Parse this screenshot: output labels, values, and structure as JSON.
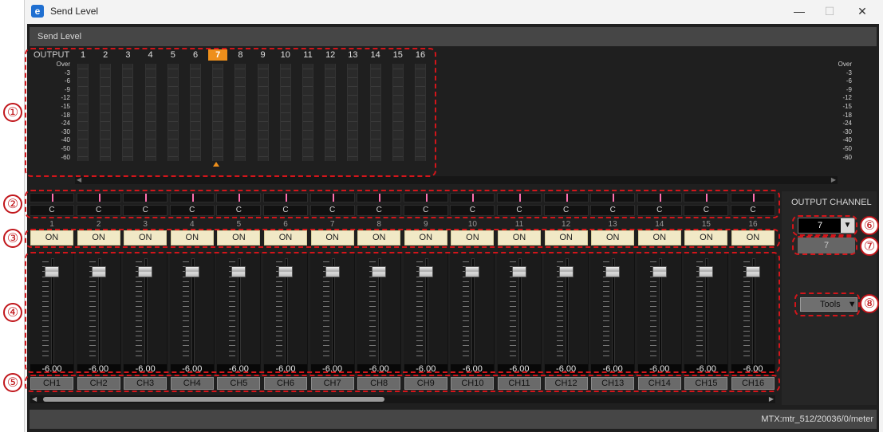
{
  "window": {
    "title": "Send Level",
    "minimize": "—",
    "maximize": "☐",
    "close": "✕"
  },
  "section_title": "Send Level",
  "meter": {
    "output_label": "OUTPUT",
    "outputs": [
      "1",
      "2",
      "3",
      "4",
      "5",
      "6",
      "7",
      "8",
      "9",
      "10",
      "11",
      "12",
      "13",
      "14",
      "15",
      "16"
    ],
    "selected_output": "7",
    "scale": [
      "Over",
      "-3",
      "-6",
      "-9",
      "-12",
      "-15",
      "-18",
      "-24",
      "-30",
      "-40",
      "-50",
      "-60"
    ]
  },
  "pan": {
    "labels": [
      "C",
      "C",
      "C",
      "C",
      "C",
      "C",
      "C",
      "C",
      "C",
      "C",
      "C",
      "C",
      "C",
      "C",
      "C",
      "C"
    ]
  },
  "channel_numbers": [
    "1",
    "2",
    "3",
    "4",
    "5",
    "6",
    "7",
    "8",
    "9",
    "10",
    "11",
    "12",
    "13",
    "14",
    "15",
    "16"
  ],
  "on_buttons": [
    "ON",
    "ON",
    "ON",
    "ON",
    "ON",
    "ON",
    "ON",
    "ON",
    "ON",
    "ON",
    "ON",
    "ON",
    "ON",
    "ON",
    "ON",
    "ON"
  ],
  "fader_values": [
    "-6.00",
    "-6.00",
    "-6.00",
    "-6.00",
    "-6.00",
    "-6.00",
    "-6.00",
    "-6.00",
    "-6.00",
    "-6.00",
    "-6.00",
    "-6.00",
    "-6.00",
    "-6.00",
    "-6.00",
    "-6.00"
  ],
  "channel_names": [
    "CH1",
    "CH2",
    "CH3",
    "CH4",
    "CH5",
    "CH6",
    "CH7",
    "CH8",
    "CH9",
    "CH10",
    "CH11",
    "CH12",
    "CH13",
    "CH14",
    "CH15",
    "CH16"
  ],
  "output_channel": {
    "title": "OUTPUT CHANNEL",
    "selected": "7",
    "display": "7"
  },
  "tools_label": "Tools",
  "status_text": "MTX:mtr_512/20036/0/meter",
  "callouts": [
    "①",
    "②",
    "③",
    "④",
    "⑤",
    "⑥",
    "⑦",
    "⑧"
  ],
  "colors": {
    "accent": "#ee8f1b",
    "pan_indicator": "#ff6fb0",
    "on_button": "#f1e9c6",
    "callout": "#c1161b"
  }
}
